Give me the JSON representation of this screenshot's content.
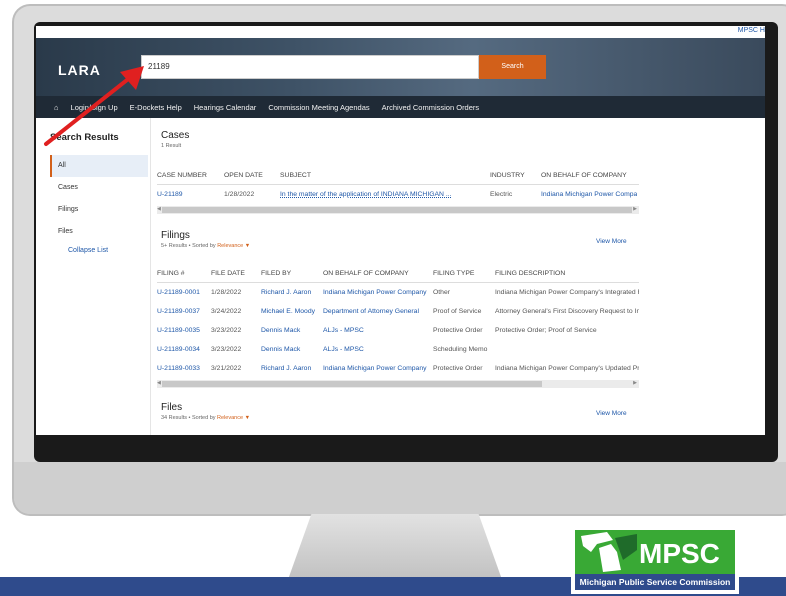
{
  "header": {
    "top_right_link": "MPSC H",
    "logo": "LARA",
    "search_value": "21189",
    "search_button": "Search"
  },
  "nav": {
    "items": [
      "Login/Sign Up",
      "E-Dockets Help",
      "Hearings Calendar",
      "Commission Meeting Agendas",
      "Archived Commission Orders"
    ]
  },
  "sidebar": {
    "title": "Search Results",
    "items": [
      "All",
      "Cases",
      "Filings",
      "Files"
    ],
    "collapse": "Collapse List"
  },
  "cases": {
    "title": "Cases",
    "count": "1 Result",
    "columns": [
      "CASE NUMBER",
      "OPEN DATE",
      "SUBJECT",
      "INDUSTRY",
      "ON BEHALF OF COMPANY"
    ],
    "rows": [
      [
        "U-21189",
        "1/28/2022",
        "In the matter of the application of INDIANA MICHIGAN ...",
        "Electric",
        "Indiana Michigan Power Company"
      ]
    ]
  },
  "filings": {
    "title": "Filings",
    "meta_prefix": "5+ Results • Sorted by",
    "sort": "Relevance",
    "view_more": "View More",
    "columns": [
      "FILING #",
      "FILE DATE",
      "FILED BY",
      "ON BEHALF OF COMPANY",
      "FILING TYPE",
      "FILING DESCRIPTION"
    ],
    "rows": [
      [
        "U-21189-0001",
        "1/28/2022",
        "Richard J. Aaron",
        "Indiana Michigan Power Company",
        "Other",
        "Indiana Michigan Power Company's Integrated Resource"
      ],
      [
        "U-21189-0037",
        "3/24/2022",
        "Michael E. Moody",
        "Department of Attorney General",
        "Proof of Service",
        "Attorney General's First Discovery Request to Indiana"
      ],
      [
        "U-21189-0035",
        "3/23/2022",
        "Dennis Mack",
        "ALJs - MPSC",
        "Protective Order",
        "Protective Order; Proof of Service"
      ],
      [
        "U-21189-0034",
        "3/23/2022",
        "Dennis Mack",
        "ALJs - MPSC",
        "Scheduling Memo",
        ""
      ],
      [
        "U-21189-0033",
        "3/21/2022",
        "Richard J. Aaron",
        "Indiana Michigan Power Company",
        "Protective Order",
        "Indiana Michigan Power Company's Updated Pre"
      ]
    ]
  },
  "files": {
    "title": "Files",
    "meta_prefix": "34 Results • Sorted by",
    "sort": "Relevance",
    "view_more": "View More"
  },
  "brand": {
    "mpsc": "MPSC",
    "tagline": "Michigan Public Service Commission"
  }
}
